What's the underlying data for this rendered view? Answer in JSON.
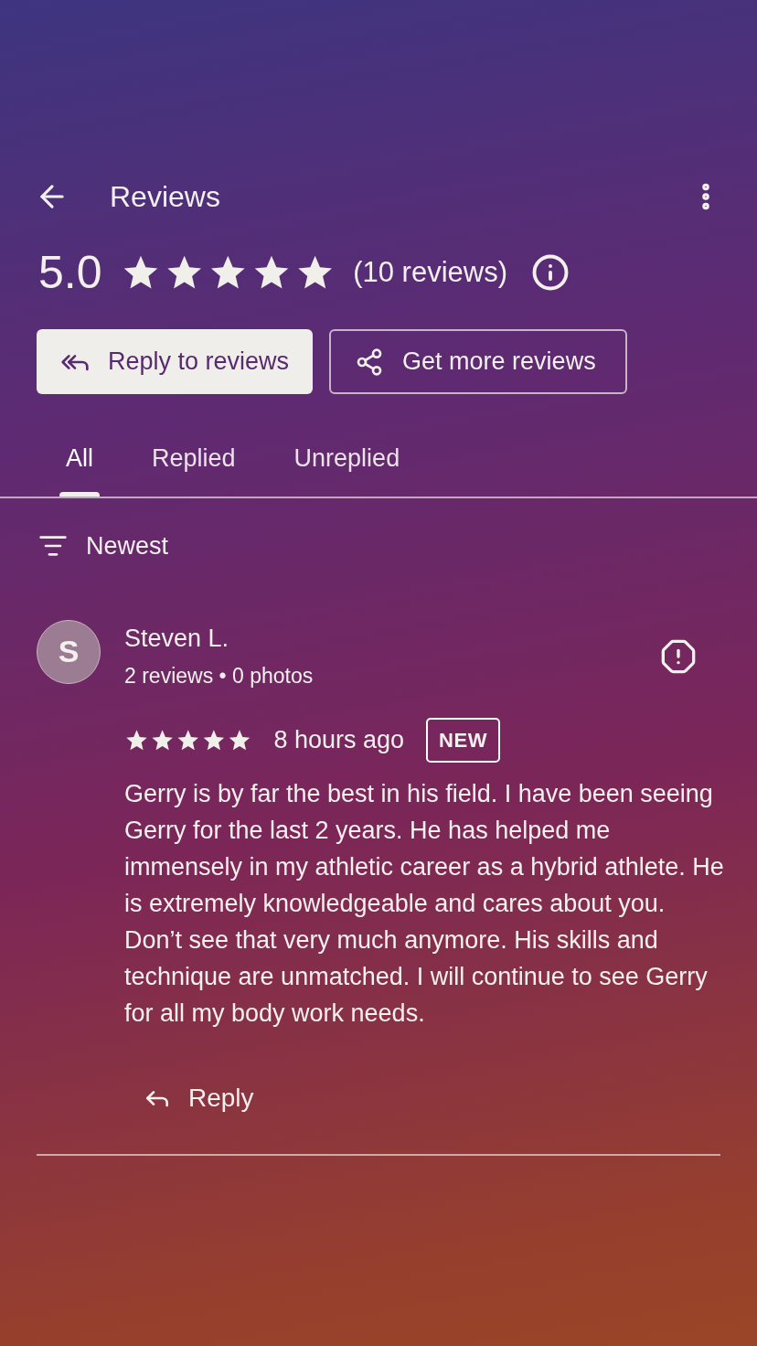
{
  "header": {
    "title": "Reviews"
  },
  "summary": {
    "rating": "5.0",
    "stars": 5,
    "count": "(10 reviews)"
  },
  "actions": [
    {
      "label": "Reply to reviews",
      "kind": "filled"
    },
    {
      "label": "Get more reviews",
      "kind": "outlined"
    }
  ],
  "tabs": [
    {
      "label": "All",
      "selected": true
    },
    {
      "label": "Replied",
      "selected": false
    },
    {
      "label": "Unreplied",
      "selected": false
    }
  ],
  "sort": {
    "label": "Newest"
  },
  "reviews": [
    {
      "initial": "S",
      "name": "Steven L.",
      "meta": "2 reviews • 0 photos",
      "stars": 5,
      "time": "8 hours ago",
      "badge": "NEW",
      "text": "Gerry is by far the best in his field. I have been seeing Gerry for the last 2 years. He has helped me immensely in my athletic career as a hybrid athlete. He is extremely knowledgeable and cares about you. Don’t see that very much anymore. His skills and technique are unmatched. I will continue to see Gerry for all my body work needs.",
      "reply": "Reply"
    }
  ]
}
